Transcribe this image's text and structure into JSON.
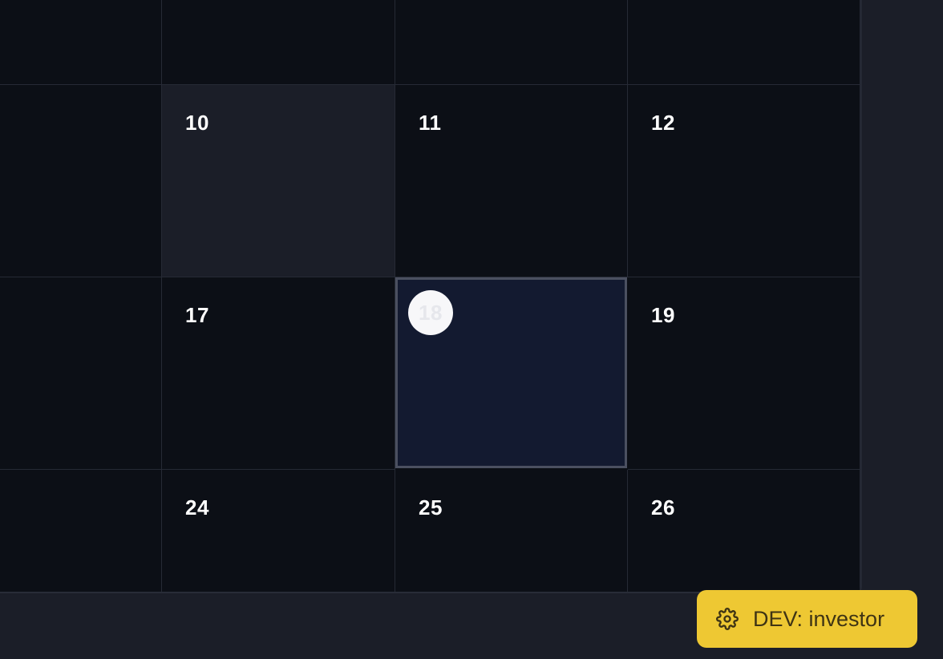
{
  "calendar": {
    "rows": [
      {
        "cells": [
          {
            "day": ""
          },
          {
            "day": ""
          },
          {
            "day": ""
          },
          {
            "day": ""
          }
        ]
      },
      {
        "cells": [
          {
            "day": ""
          },
          {
            "day": "10",
            "muted": true
          },
          {
            "day": "11"
          },
          {
            "day": "12"
          }
        ]
      },
      {
        "cells": [
          {
            "day": ""
          },
          {
            "day": "17"
          },
          {
            "day": "18",
            "selected": true
          },
          {
            "day": "19"
          }
        ]
      },
      {
        "cells": [
          {
            "day": ""
          },
          {
            "day": "24"
          },
          {
            "day": "25"
          },
          {
            "day": "26"
          }
        ]
      }
    ]
  },
  "dev_badge": {
    "label": "DEV: investor",
    "icon": "gear-icon",
    "color": "#eec833"
  },
  "colors": {
    "background": "#1b1e28",
    "cell": "#0c0f16",
    "selected_cell": "#131a30"
  }
}
